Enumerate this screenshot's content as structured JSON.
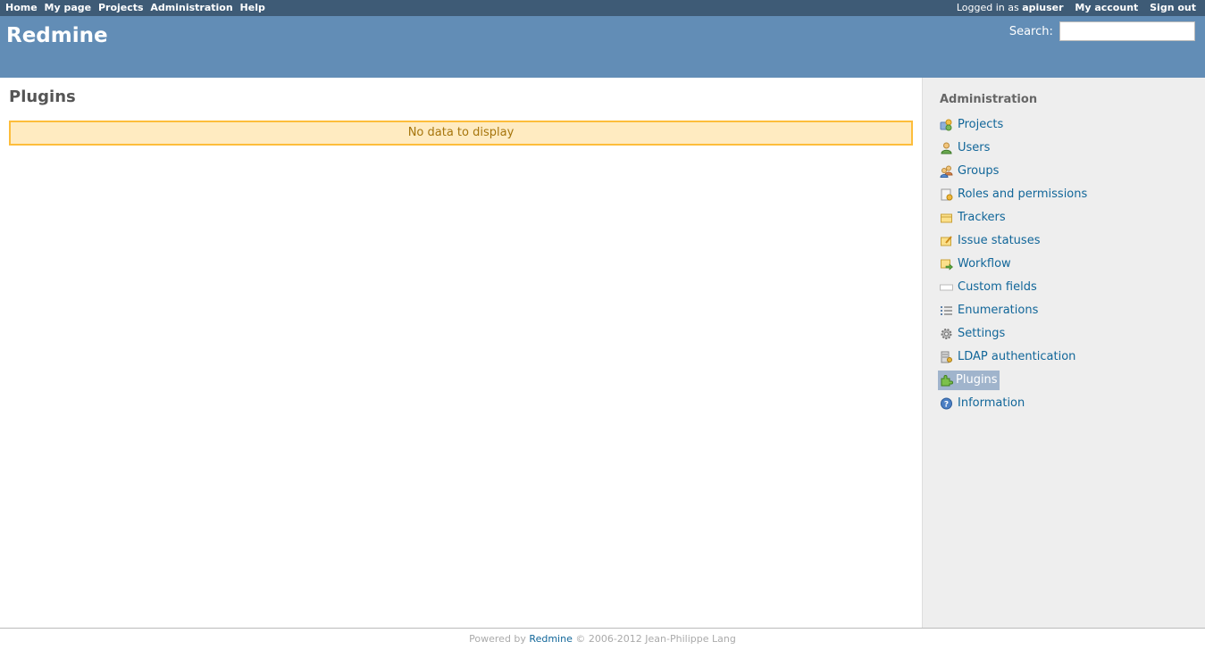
{
  "top_menu": {
    "items": [
      "Home",
      "My page",
      "Projects",
      "Administration",
      "Help"
    ],
    "logged_in_prefix": "Logged in as",
    "username": "apiuser",
    "my_account": "My account",
    "sign_out": "Sign out"
  },
  "header": {
    "title": "Redmine",
    "search_label": "Search:",
    "search_value": ""
  },
  "main": {
    "title": "Plugins",
    "nodata": "No data to display"
  },
  "sidebar": {
    "title": "Administration",
    "items": [
      {
        "label": "Projects",
        "icon": "projects-icon"
      },
      {
        "label": "Users",
        "icon": "user-icon"
      },
      {
        "label": "Groups",
        "icon": "group-icon"
      },
      {
        "label": "Roles and permissions",
        "icon": "roles-icon"
      },
      {
        "label": "Trackers",
        "icon": "tracker-icon"
      },
      {
        "label": "Issue statuses",
        "icon": "issue-status-icon"
      },
      {
        "label": "Workflow",
        "icon": "workflow-icon"
      },
      {
        "label": "Custom fields",
        "icon": "custom-fields-icon"
      },
      {
        "label": "Enumerations",
        "icon": "list-icon"
      },
      {
        "label": "Settings",
        "icon": "gear-icon"
      },
      {
        "label": "LDAP authentication",
        "icon": "server-key-icon"
      },
      {
        "label": "Plugins",
        "icon": "plugin-icon",
        "selected": true
      },
      {
        "label": "Information",
        "icon": "help-icon"
      }
    ]
  },
  "footer": {
    "prefix": "Powered by",
    "link": "Redmine",
    "suffix": "© 2006-2012 Jean-Philippe Lang"
  },
  "colors": {
    "top_menu_bg": "#3e5b76",
    "header_bg": "#628db6",
    "link": "#116699",
    "nodata_bg": "#ffebc1",
    "nodata_border": "#fdbd3b",
    "sidebar_bg": "#eeeeee"
  }
}
